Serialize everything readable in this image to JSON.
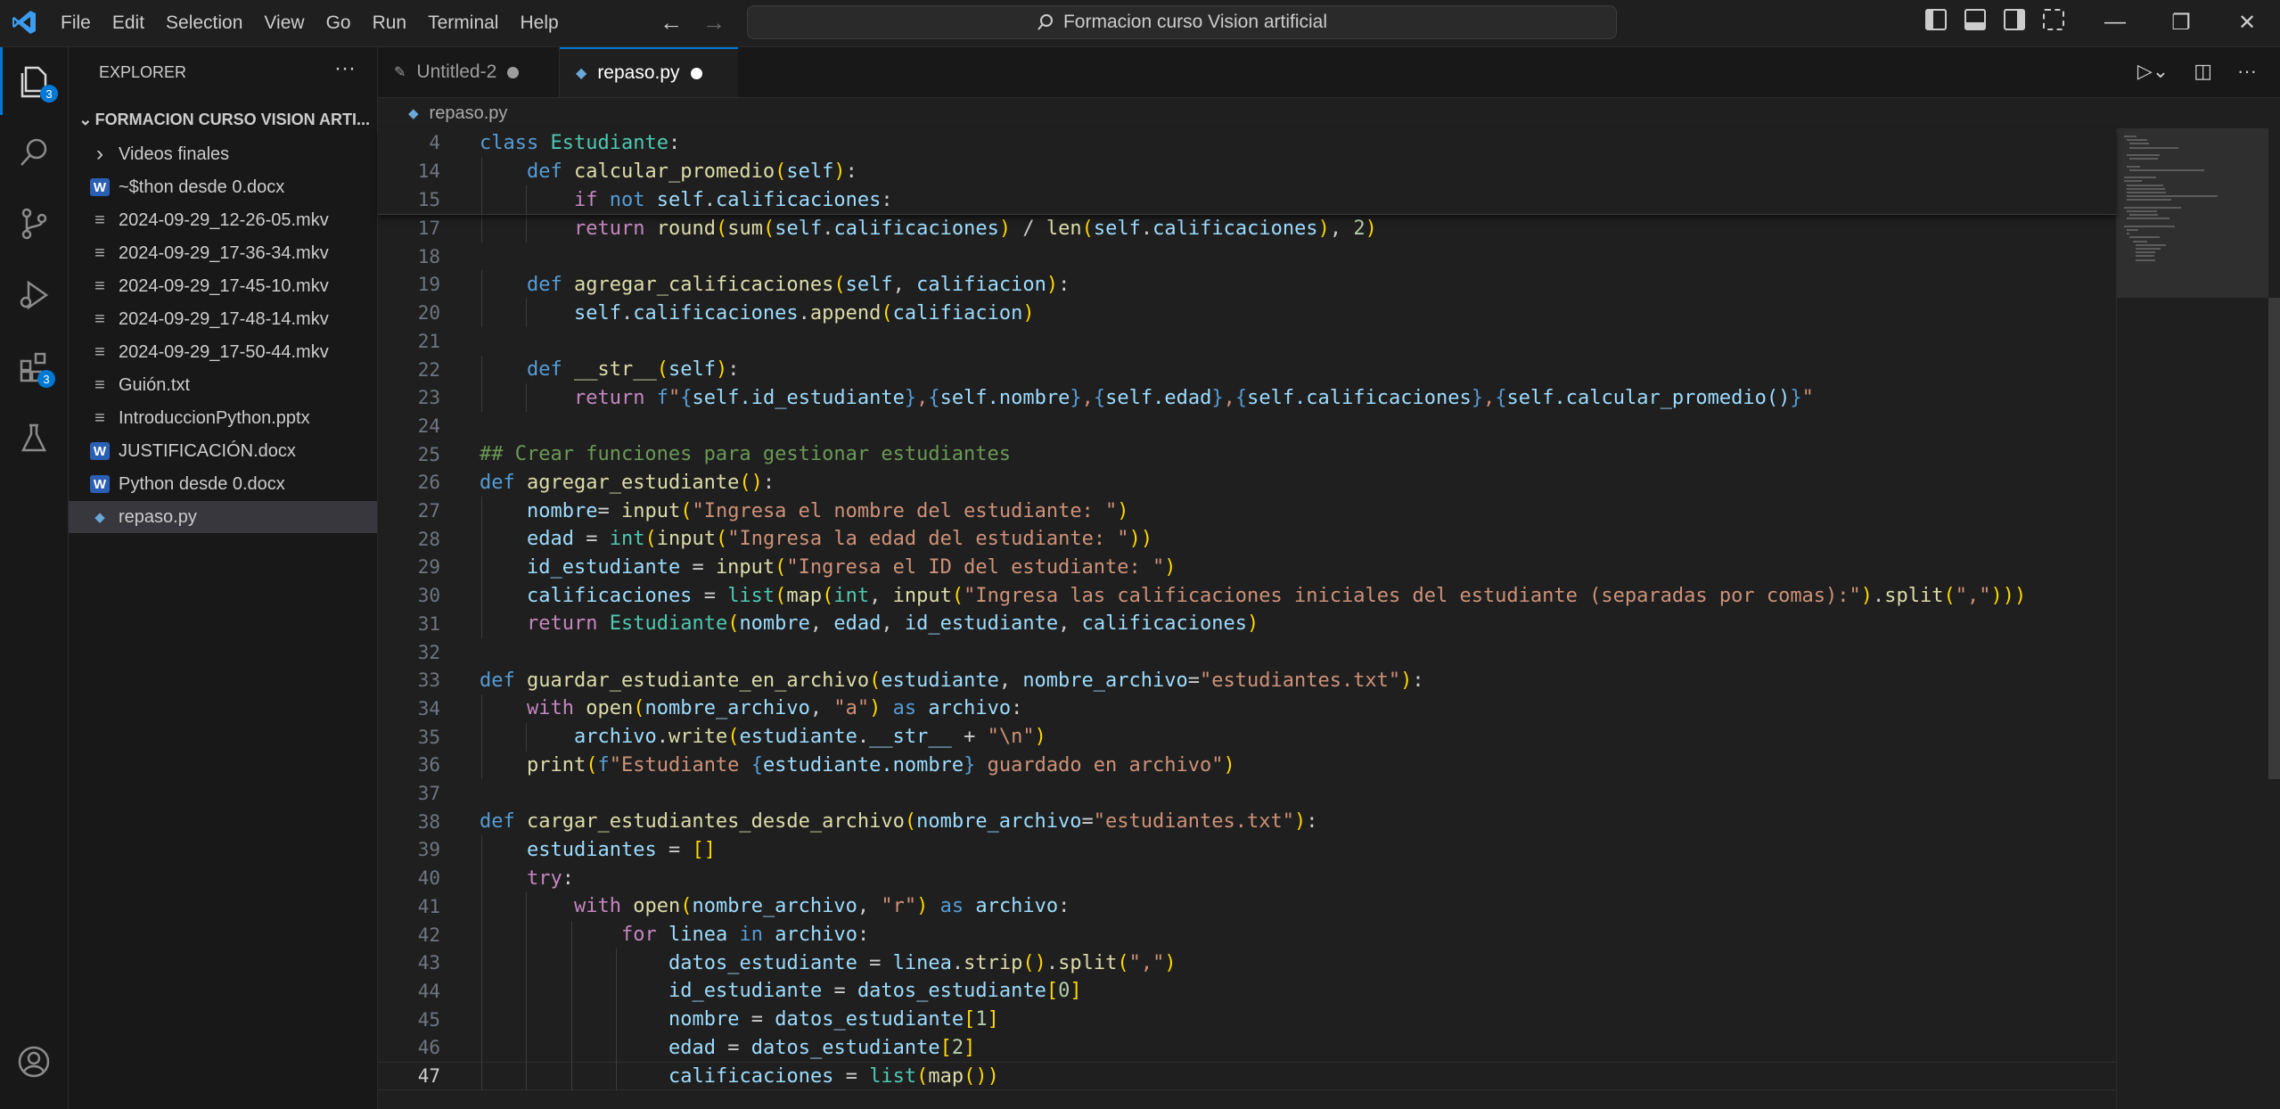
{
  "menu": [
    "File",
    "Edit",
    "Selection",
    "View",
    "Go",
    "Run",
    "Terminal",
    "Help"
  ],
  "search": {
    "text": "Formacion curso Vision artificial"
  },
  "activity": {
    "explorer_badge": "3",
    "extensions_badge": "3"
  },
  "sidebar": {
    "header": "EXPLORER",
    "more": "···",
    "folder": "FORMACION CURSO VISION ARTI...",
    "items": [
      {
        "label": "Videos finales",
        "type": "folder"
      },
      {
        "label": "~$thon desde 0.docx",
        "type": "word"
      },
      {
        "label": "2024-09-29_12-26-05.mkv",
        "type": "file"
      },
      {
        "label": "2024-09-29_17-36-34.mkv",
        "type": "file"
      },
      {
        "label": "2024-09-29_17-45-10.mkv",
        "type": "file"
      },
      {
        "label": "2024-09-29_17-48-14.mkv",
        "type": "file"
      },
      {
        "label": "2024-09-29_17-50-44.mkv",
        "type": "file"
      },
      {
        "label": "Guión.txt",
        "type": "file"
      },
      {
        "label": "IntroduccionPython.pptx",
        "type": "file"
      },
      {
        "label": "JUSTIFICACIÓN.docx",
        "type": "word"
      },
      {
        "label": "Python desde 0.docx",
        "type": "word"
      },
      {
        "label": "repaso.py",
        "type": "python"
      }
    ]
  },
  "tabs": [
    {
      "label": "Untitled-2",
      "active": false
    },
    {
      "label": "repaso.py",
      "active": true
    }
  ],
  "breadcrumb": "repaso.py",
  "sticky_lines": [
    {
      "num": "4",
      "code": "class Estudiante:"
    },
    {
      "num": "14",
      "code": "    def calcular_promedio(self):"
    },
    {
      "num": "15",
      "code": "        if not self.calificaciones:"
    }
  ],
  "code_lines": [
    {
      "num": "17",
      "code": "        return round(sum(self.calificaciones) / len(self.calificaciones), 2)"
    },
    {
      "num": "18",
      "code": ""
    },
    {
      "num": "19",
      "code": "    def agregar_calificaciones(self, califiacion):"
    },
    {
      "num": "20",
      "code": "        self.calificaciones.append(califiacion)"
    },
    {
      "num": "21",
      "code": ""
    },
    {
      "num": "22",
      "code": "    def __str__(self):"
    },
    {
      "num": "23",
      "code": "        return f\"{self.id_estudiante},{self.nombre},{self.edad},{self.calificaciones},{self.calcular_promedio()}\""
    },
    {
      "num": "24",
      "code": ""
    },
    {
      "num": "25",
      "code": "## Crear funciones para gestionar estudiantes"
    },
    {
      "num": "26",
      "code": "def agregar_estudiante():"
    },
    {
      "num": "27",
      "code": "    nombre= input(\"Ingresa el nombre del estudiante: \")"
    },
    {
      "num": "28",
      "code": "    edad = int(input(\"Ingresa la edad del estudiante: \"))"
    },
    {
      "num": "29",
      "code": "    id_estudiante = input(\"Ingresa el ID del estudiante: \")"
    },
    {
      "num": "30",
      "code": "    calificaciones = list(map(int, input(\"Ingresa las calificaciones iniciales del estudiante (separadas por comas):\").split(\",\")))"
    },
    {
      "num": "31",
      "code": "    return Estudiante(nombre, edad, id_estudiante, calificaciones)"
    },
    {
      "num": "32",
      "code": ""
    },
    {
      "num": "33",
      "code": "def guardar_estudiante_en_archivo(estudiante, nombre_archivo=\"estudiantes.txt\"):"
    },
    {
      "num": "34",
      "code": "    with open(nombre_archivo, \"a\") as archivo:"
    },
    {
      "num": "35",
      "code": "        archivo.write(estudiante.__str__ + \"\\n\")"
    },
    {
      "num": "36",
      "code": "    print(f\"Estudiante {estudiante.nombre} guardado en archivo\")"
    },
    {
      "num": "37",
      "code": ""
    },
    {
      "num": "38",
      "code": "def cargar_estudiantes_desde_archivo(nombre_archivo=\"estudiantes.txt\"):"
    },
    {
      "num": "39",
      "code": "    estudiantes = []"
    },
    {
      "num": "40",
      "code": "    try:"
    },
    {
      "num": "41",
      "code": "        with open(nombre_archivo, \"r\") as archivo:"
    },
    {
      "num": "42",
      "code": "            for linea in archivo:"
    },
    {
      "num": "43",
      "code": "                datos_estudiante = linea.strip().split(\",\")"
    },
    {
      "num": "44",
      "code": "                id_estudiante = datos_estudiante[0]"
    },
    {
      "num": "45",
      "code": "                nombre = datos_estudiante[1]"
    },
    {
      "num": "46",
      "code": "                edad = datos_estudiante[2]"
    },
    {
      "num": "47",
      "code": "                calificaciones = list(map())"
    }
  ],
  "current_line": "47",
  "colors": {
    "accent": "#0078d4",
    "background": "#1f1f1f",
    "sidebar": "#181818"
  }
}
